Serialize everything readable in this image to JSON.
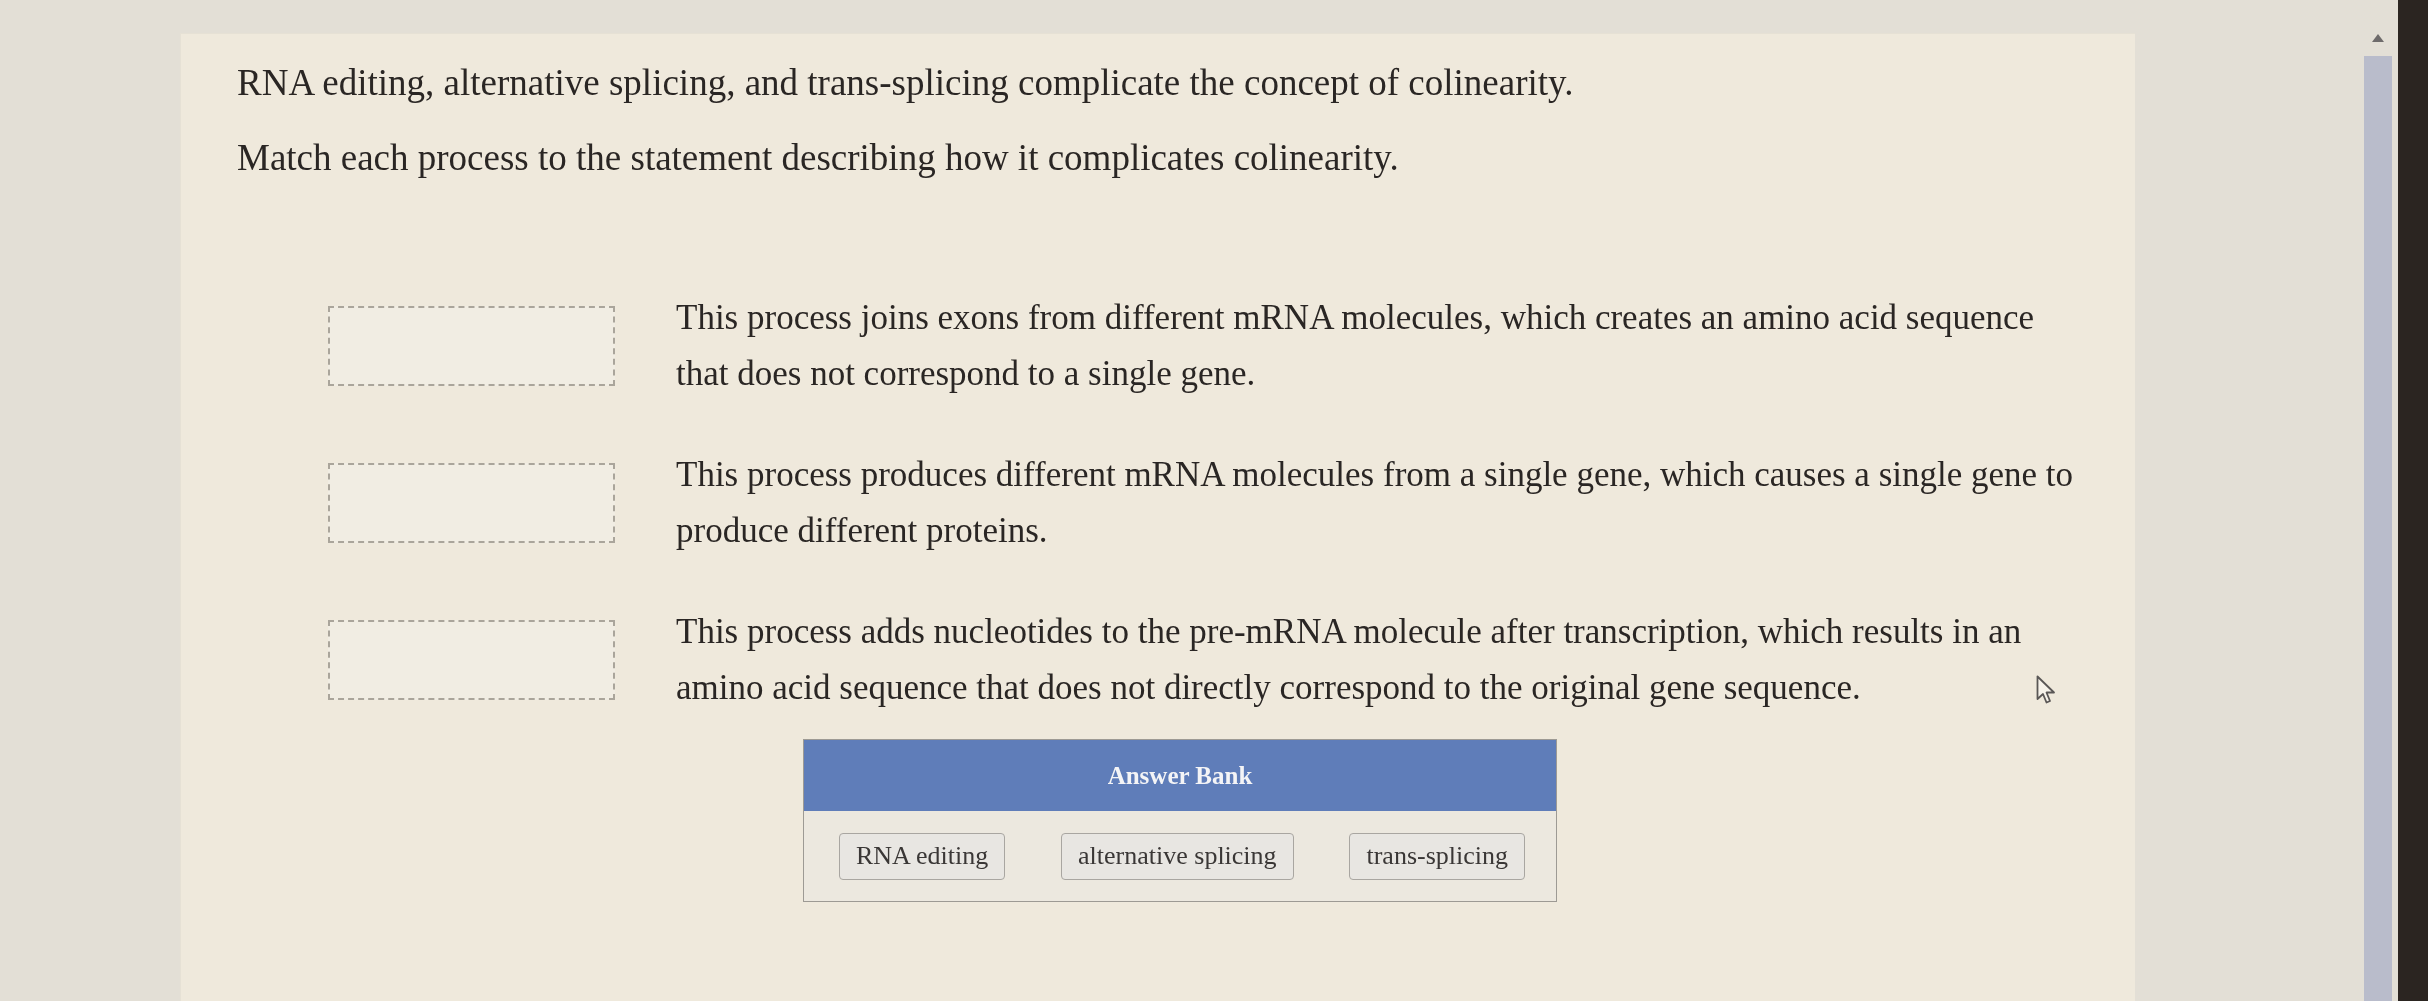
{
  "question": {
    "intro": "RNA editing, alternative splicing, and trans-splicing complicate the concept of colinearity.",
    "instruction": "Match each process to the statement describing how it complicates colinearity."
  },
  "matches": [
    {
      "statement": "This process joins exons from different mRNA molecules, which creates an amino acid sequence that does not correspond to a single gene."
    },
    {
      "statement": "This process produces different mRNA molecules from a single gene, which causes a single gene to produce different proteins."
    },
    {
      "statement": "This process adds nucleotides to the pre-mRNA molecule after transcription, which results in an amino acid sequence that does not directly correspond to the original gene sequence."
    }
  ],
  "answer_bank": {
    "title": "Answer Bank",
    "answers": [
      "RNA editing",
      "alternative splicing",
      "trans-splicing"
    ]
  }
}
